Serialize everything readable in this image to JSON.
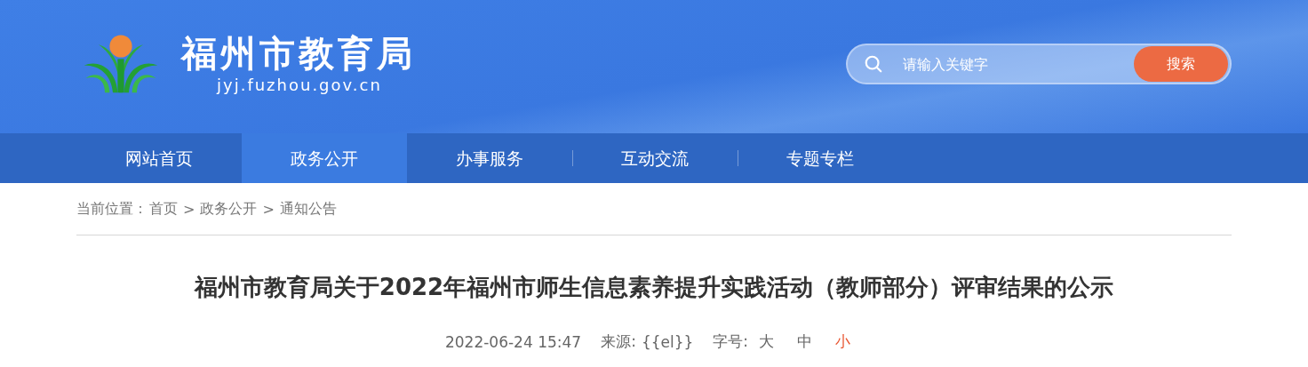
{
  "header": {
    "site_name": "福州市教育局",
    "domain": "jyj.fuzhou.gov.cn"
  },
  "search": {
    "placeholder": "请输入关键字",
    "button": "搜索"
  },
  "nav": [
    {
      "label": "网站首页",
      "selected": false
    },
    {
      "label": "政务公开",
      "selected": true
    },
    {
      "label": "办事服务",
      "selected": false
    },
    {
      "label": "互动交流",
      "selected": false
    },
    {
      "label": "专题专栏",
      "selected": false
    }
  ],
  "breadcrumb": {
    "label": "当前位置：",
    "items": [
      "首页",
      "政务公开",
      "通知公告"
    ],
    "separator": ">"
  },
  "article": {
    "title": "福州市教育局关于2022年福州市师生信息素养提升实践活动（教师部分）评审结果的公示",
    "date": "2022-06-24 15:47",
    "source_label": "来源:",
    "source": "{{el}}",
    "font_size_label": "字号:",
    "font_sizes": [
      {
        "label": "大",
        "selected": false
      },
      {
        "label": "中",
        "selected": false
      },
      {
        "label": "小",
        "selected": true
      }
    ]
  }
}
